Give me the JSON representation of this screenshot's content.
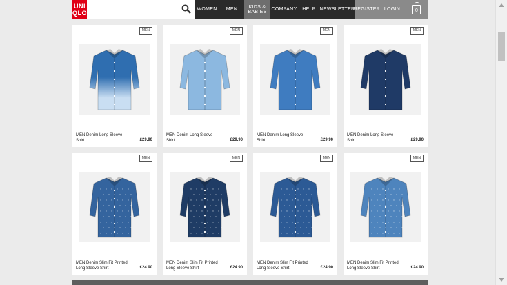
{
  "logo": {
    "line1": "UNI",
    "line2": "QLO"
  },
  "nav": [
    {
      "label": "WOMEN"
    },
    {
      "label": "MEN"
    },
    {
      "label": "KIDS &\nBABIES"
    },
    {
      "label": "COMPANY"
    },
    {
      "label": "HELP"
    },
    {
      "label": "NEWSLETTER"
    },
    {
      "label": "REGISTER"
    },
    {
      "label": "LOGIN"
    }
  ],
  "cart": {
    "count": "0"
  },
  "products": [
    {
      "badge": "MEN",
      "name": "MEN Denim Long Sleeve Shirt",
      "price": "£29.90",
      "shirt": "dip-dye"
    },
    {
      "badge": "MEN",
      "name": "MEN Denim Long Sleeve Shirt",
      "price": "£29.90",
      "shirt": "light-denim"
    },
    {
      "badge": "MEN",
      "name": "MEN Denim Long Sleeve Shirt",
      "price": "£29.90",
      "shirt": "medium-denim"
    },
    {
      "badge": "MEN",
      "name": "MEN Denim Long Sleeve Shirt",
      "price": "£29.90",
      "shirt": "dark-denim"
    },
    {
      "badge": "MEN",
      "name": "MEN Denim Slim Fit Printed Long Sleeve Shirt",
      "price": "£24.90",
      "shirt": "printed-blue"
    },
    {
      "badge": "MEN",
      "name": "MEN Denim Slim Fit Printed Long Sleeve Shirt",
      "price": "£24.90",
      "shirt": "printed-navy"
    },
    {
      "badge": "MEN",
      "name": "MEN Denim Slim Fit Printed Long Sleeve Shirt",
      "price": "£24.90",
      "shirt": "printed-dot"
    },
    {
      "badge": "MEN",
      "name": "MEN Denim Slim Fit Printed Long Sleeve Shirt",
      "price": "£24.90",
      "shirt": "printed-floral"
    }
  ],
  "colors": {
    "brand": "#e00016",
    "header": "#2a2a2a",
    "shirts": {
      "dip-dye": "#2f6eb0",
      "light-denim": "#8cb8e0",
      "medium-denim": "#3f7cc0",
      "dark-denim": "#1f3a66",
      "printed-blue": "#34649e",
      "printed-navy": "#1f3c65",
      "printed-dot": "#2c5a95",
      "printed-floral": "#4e84bd"
    }
  }
}
